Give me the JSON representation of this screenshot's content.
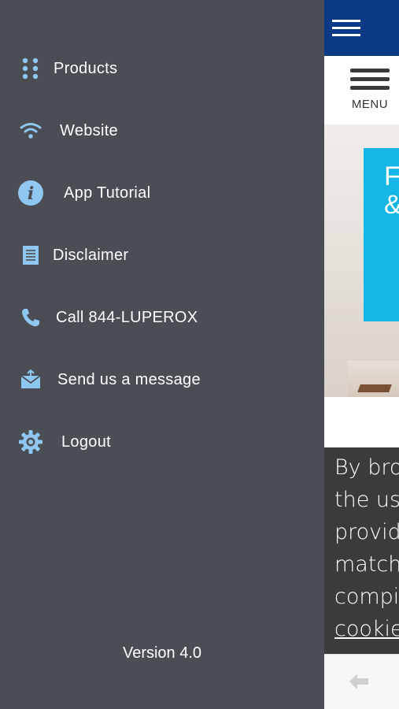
{
  "drawer": {
    "items": [
      {
        "label": "Products",
        "icon": "grid-dots-icon"
      },
      {
        "label": "Website",
        "icon": "wifi-icon"
      },
      {
        "label": "App Tutorial",
        "icon": "info-icon"
      },
      {
        "label": "Disclaimer",
        "icon": "document-icon"
      },
      {
        "label": "Call 844-LUPEROX",
        "icon": "phone-icon"
      },
      {
        "label": "Send us a message",
        "icon": "envelope-icon"
      },
      {
        "label": "Logout",
        "icon": "gear-icon"
      }
    ],
    "version": "Version 4.0",
    "icon_color": "#8fc7f0",
    "background": "#4a4d53"
  },
  "page": {
    "menu_label": "MENU",
    "hero_text": [
      "F",
      "&"
    ],
    "cookie_lines": [
      "By brov",
      "the use",
      "provide",
      "matchir",
      "compile",
      "cookies"
    ],
    "colors": {
      "topbar": "#0a3a86",
      "hero_panel": "#15b5e6",
      "cookie_bg": "#3b3b3b"
    }
  }
}
